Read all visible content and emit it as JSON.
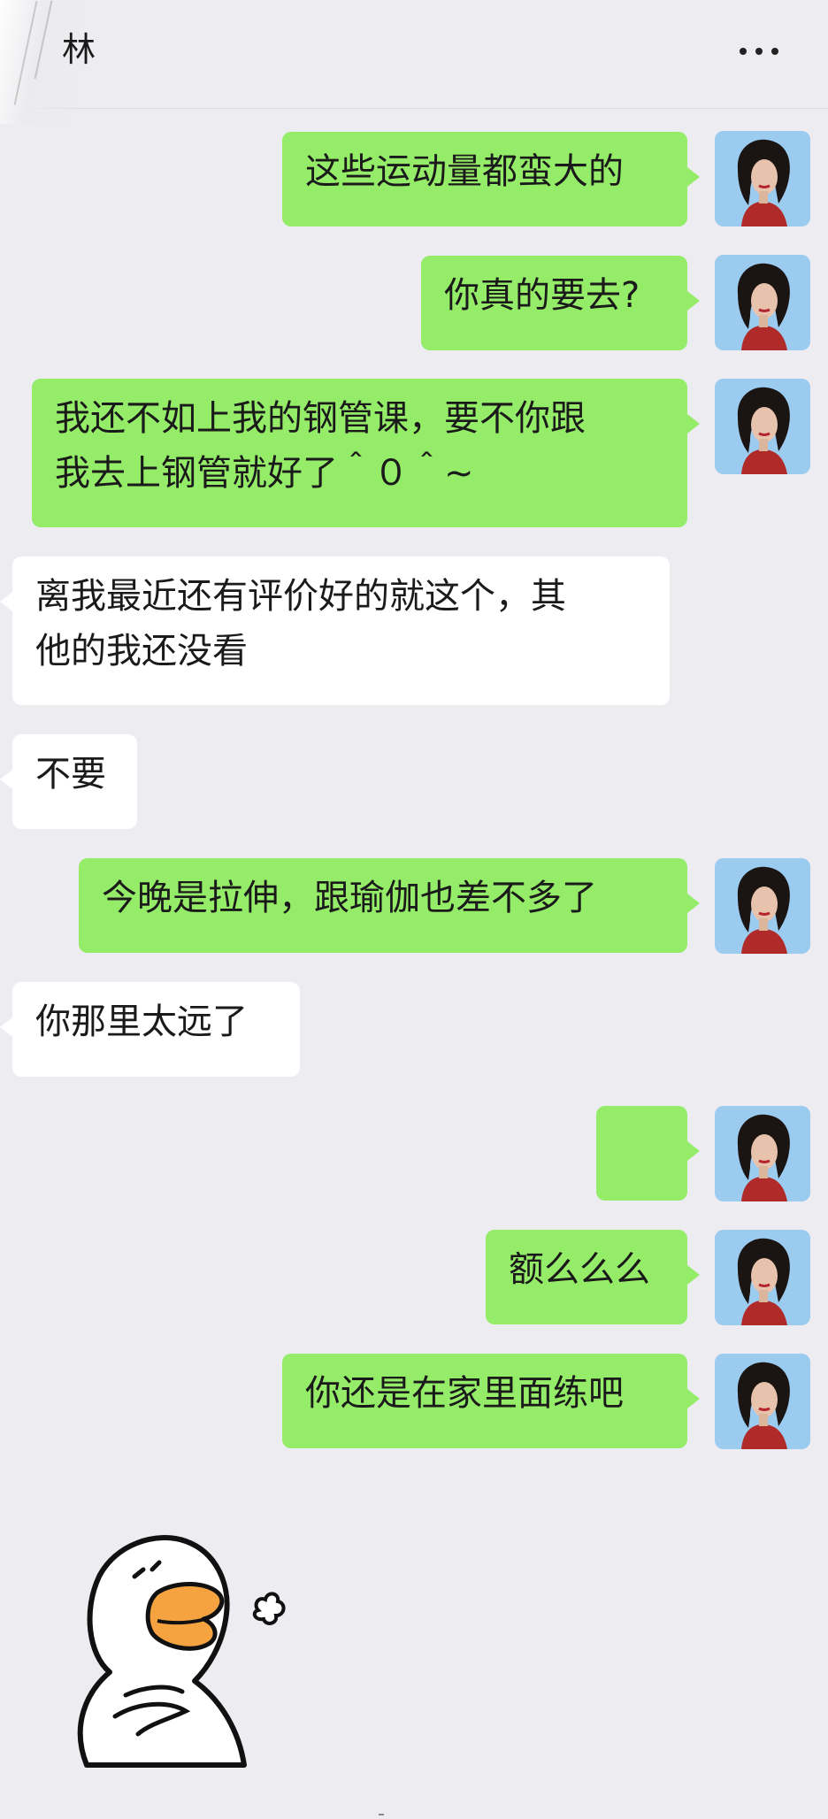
{
  "header": {
    "title": "林"
  },
  "messages": [
    {
      "sender": "me",
      "text": "这些运动量都蛮大的"
    },
    {
      "sender": "me",
      "text": "你真的要去?"
    },
    {
      "sender": "me",
      "text": "我还不如上我的钢管课，要不你跟\n我去上钢管就好了＾０＾~"
    },
    {
      "sender": "them",
      "text": "离我最近还有评价好的就这个，其\n他的我还没看"
    },
    {
      "sender": "them",
      "text": "不要"
    },
    {
      "sender": "me",
      "text": "今晚是拉伸，跟瑜伽也差不多了"
    },
    {
      "sender": "them",
      "text": "你那里太远了"
    },
    {
      "sender": "me",
      "text": "",
      "emoji": "shocked-face"
    },
    {
      "sender": "me",
      "text": "额么么么"
    },
    {
      "sender": "me",
      "text": "你还是在家里面练吧"
    }
  ],
  "sticker": {
    "icon": "duck-sticker"
  },
  "colors": {
    "background": "#edecf0",
    "my_bubble": "#95ec69",
    "their_bubble": "#ffffff"
  }
}
